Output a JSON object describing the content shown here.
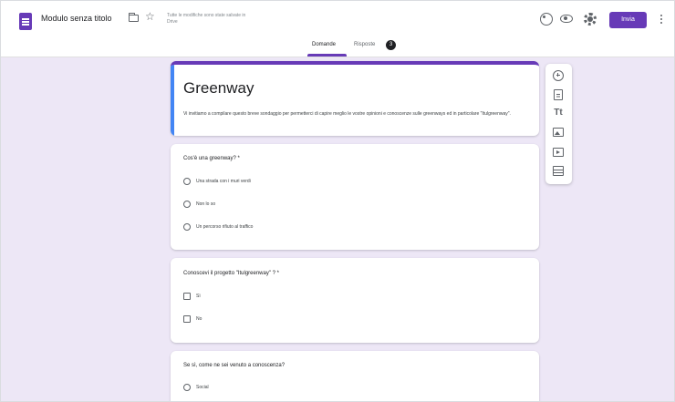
{
  "header": {
    "doc_title": "Modulo senza titolo",
    "save_note": "Tutte le modifiche sono state salvate in Drive",
    "send_label": "Invia"
  },
  "tabs": {
    "questions_label": "Domande",
    "responses_label": "Risposte",
    "responses_count": "3"
  },
  "form": {
    "title": "Greenway",
    "description": "Vi invitiamo a compilare questo breve sondaggio per permetterci di capire meglio le vostre opinioni e conoscenze sulle greenways ed in particolare \"Itulgreenway\"."
  },
  "questions": [
    {
      "text": "Cos'è una greenway? *",
      "options": [
        "Una strada con i muri verdi",
        "Non lo so",
        "Un percorso rifiuto al traffico"
      ]
    },
    {
      "text": "Conoscevi il progetto \"Itulgreenway\" ? *",
      "options": [
        "Sì",
        "No"
      ]
    },
    {
      "text": "Se sì, come ne sei venuto a conoscenza?",
      "options": [
        "Social"
      ]
    }
  ],
  "colors": {
    "accent": "#673ab7",
    "background": "#ede7f6",
    "focus_bar": "#4285f4"
  },
  "icons": [
    "doc-icon",
    "folder-icon",
    "star-icon",
    "palette-icon",
    "eye-icon",
    "gear-icon",
    "more-icon",
    "add-question-icon",
    "import-icon",
    "title-text-icon",
    "image-icon",
    "video-icon",
    "section-icon"
  ]
}
